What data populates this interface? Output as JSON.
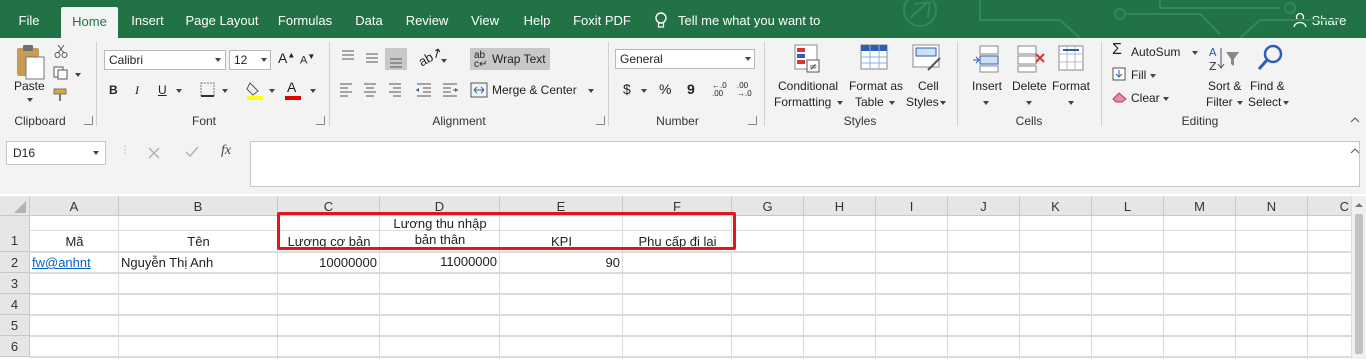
{
  "tabs": [
    "File",
    "Home",
    "Insert",
    "Page Layout",
    "Formulas",
    "Data",
    "Review",
    "View",
    "Help",
    "Foxit PDF"
  ],
  "tell_me": "Tell me what you want to do",
  "share": "Share",
  "clipboard": {
    "paste": "Paste",
    "label": "Clipboard"
  },
  "font": {
    "name": "Calibri",
    "size": "12",
    "label": "Font",
    "bold": "B",
    "italic": "I",
    "underline": "U"
  },
  "alignment": {
    "wrap_text": "Wrap Text",
    "merge_center": "Merge & Center",
    "label": "Alignment"
  },
  "number": {
    "format": "General",
    "label": "Number",
    "currency": "$",
    "percent": "%",
    "comma": "9"
  },
  "styles": {
    "conditional_1": "Conditional",
    "conditional_2": "Formatting",
    "format_table_1": "Format as",
    "format_table_2": "Table",
    "cell_styles_1": "Cell",
    "cell_styles_2": "Styles",
    "label": "Styles"
  },
  "cells": {
    "insert": "Insert",
    "delete": "Delete",
    "format": "Format",
    "label": "Cells"
  },
  "editing": {
    "autosum": "AutoSum",
    "fill": "Fill",
    "clear": "Clear",
    "sort_1": "Sort &",
    "sort_2": "Filter",
    "find_1": "Find &",
    "find_2": "Select",
    "label": "Editing"
  },
  "formula_bar": {
    "name_box": "D16",
    "fx": "fx",
    "formula": ""
  },
  "columns": [
    "A",
    "B",
    "C",
    "D",
    "E",
    "F",
    "G",
    "H",
    "I",
    "J",
    "K",
    "L",
    "M",
    "N",
    "C"
  ],
  "rows": [
    "1",
    "2",
    "3",
    "4",
    "5",
    "6"
  ],
  "sheet": {
    "A1": "Mã",
    "B1": "Tên",
    "C1": "Lương cơ bản",
    "D1_line1": "Lương thu nhập",
    "D1_line2": "bản thân",
    "E1": "KPI",
    "F1": "Phụ cấp đi lại",
    "A2": "fw@anhnt",
    "B2": "Nguyễn Thị Anh",
    "C2": "10000000",
    "D2": "11000000",
    "E2": "90"
  },
  "colors": {
    "excel_green": "#217346",
    "highlight_red": "#e0161b",
    "link_blue": "#0563c1"
  }
}
